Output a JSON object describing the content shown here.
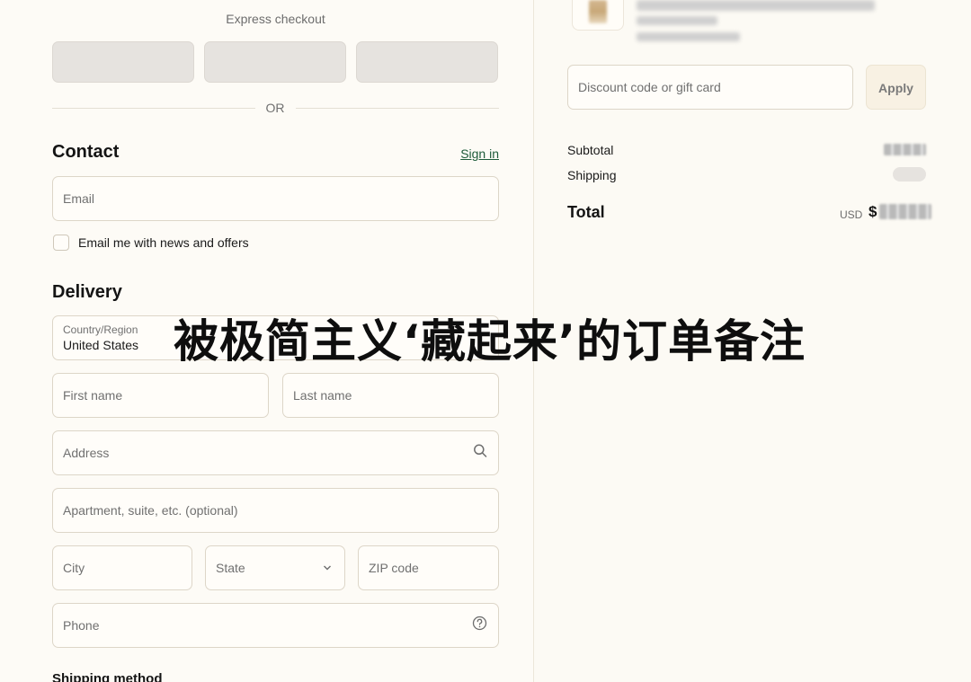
{
  "express": {
    "title": "Express checkout",
    "or_label": "OR"
  },
  "contact": {
    "title": "Contact",
    "sign_in": "Sign in",
    "email_placeholder": "Email",
    "news_label": "Email me with news and offers"
  },
  "delivery": {
    "title": "Delivery",
    "country_label": "Country/Region",
    "country_value": "United States",
    "first_name": "First name",
    "last_name": "Last name",
    "address": "Address",
    "apartment": "Apartment, suite, etc. (optional)",
    "city": "City",
    "state": "State",
    "zip": "ZIP code",
    "phone": "Phone"
  },
  "shipping_method": {
    "title": "Shipping method"
  },
  "summary": {
    "discount_placeholder": "Discount code or gift card",
    "apply": "Apply",
    "subtotal_label": "Subtotal",
    "shipping_label": "Shipping",
    "total_label": "Total",
    "currency": "USD",
    "total_prefix": "$"
  },
  "overlay": {
    "caption": "被极简主义‘藏起来’的订单备注"
  },
  "icons": {
    "search": "search-icon",
    "help": "help-circle-icon",
    "chevron": "chevron-down-icon"
  }
}
